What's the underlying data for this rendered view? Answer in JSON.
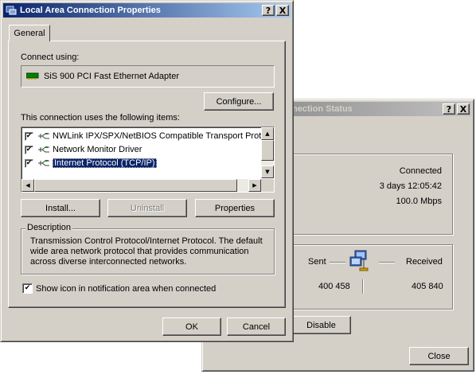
{
  "status_window": {
    "title_partial": "nection Status",
    "connection_status": "Connected",
    "duration": "3 days 12:05:42",
    "speed": "100.0 Mbps",
    "sent_label": "Sent",
    "received_label": "Received",
    "bytes_sent": "400 458",
    "bytes_received": "405 840",
    "disable_label": "Disable",
    "close_label": "Close",
    "help_glyph": "?",
    "close_glyph": "X"
  },
  "props_window": {
    "title": "Local Area Connection Properties",
    "help_glyph": "?",
    "close_glyph": "X",
    "tab_general": "General",
    "connect_using_label": "Connect using:",
    "adapter_name": "SiS 900 PCI Fast Ethernet Adapter",
    "configure_label": "Configure...",
    "items_label": "This connection uses the following items:",
    "items": [
      {
        "label": "NWLink IPX/SPX/NetBIOS Compatible Transport Proto",
        "checked": true,
        "selected": false
      },
      {
        "label": "Network Monitor Driver",
        "checked": true,
        "selected": false
      },
      {
        "label": "Internet Protocol (TCP/IP)",
        "checked": true,
        "selected": true
      }
    ],
    "install_label": "Install...",
    "uninstall_label": "Uninstall",
    "properties_label": "Properties",
    "description_title": "Description",
    "description_text": "Transmission Control Protocol/Internet Protocol. The default wide area network protocol that provides communication across diverse interconnected networks.",
    "show_icon_label": "Show icon in notification area when connected",
    "show_icon_checked": true,
    "ok_label": "OK",
    "cancel_label": "Cancel"
  }
}
